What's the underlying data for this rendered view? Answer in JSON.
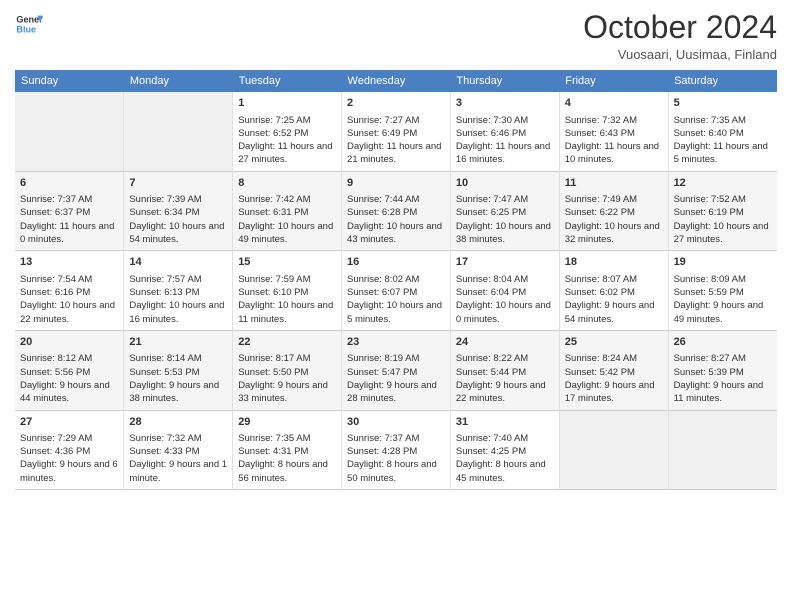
{
  "header": {
    "logo_line1": "General",
    "logo_line2": "Blue",
    "month_title": "October 2024",
    "subtitle": "Vuosaari, Uusimaa, Finland"
  },
  "days_of_week": [
    "Sunday",
    "Monday",
    "Tuesday",
    "Wednesday",
    "Thursday",
    "Friday",
    "Saturday"
  ],
  "weeks": [
    {
      "days": [
        {
          "num": "",
          "empty": true
        },
        {
          "num": "",
          "empty": true
        },
        {
          "num": "1",
          "sunrise": "Sunrise: 7:25 AM",
          "sunset": "Sunset: 6:52 PM",
          "daylight": "Daylight: 11 hours and 27 minutes."
        },
        {
          "num": "2",
          "sunrise": "Sunrise: 7:27 AM",
          "sunset": "Sunset: 6:49 PM",
          "daylight": "Daylight: 11 hours and 21 minutes."
        },
        {
          "num": "3",
          "sunrise": "Sunrise: 7:30 AM",
          "sunset": "Sunset: 6:46 PM",
          "daylight": "Daylight: 11 hours and 16 minutes."
        },
        {
          "num": "4",
          "sunrise": "Sunrise: 7:32 AM",
          "sunset": "Sunset: 6:43 PM",
          "daylight": "Daylight: 11 hours and 10 minutes."
        },
        {
          "num": "5",
          "sunrise": "Sunrise: 7:35 AM",
          "sunset": "Sunset: 6:40 PM",
          "daylight": "Daylight: 11 hours and 5 minutes."
        }
      ]
    },
    {
      "days": [
        {
          "num": "6",
          "sunrise": "Sunrise: 7:37 AM",
          "sunset": "Sunset: 6:37 PM",
          "daylight": "Daylight: 11 hours and 0 minutes."
        },
        {
          "num": "7",
          "sunrise": "Sunrise: 7:39 AM",
          "sunset": "Sunset: 6:34 PM",
          "daylight": "Daylight: 10 hours and 54 minutes."
        },
        {
          "num": "8",
          "sunrise": "Sunrise: 7:42 AM",
          "sunset": "Sunset: 6:31 PM",
          "daylight": "Daylight: 10 hours and 49 minutes."
        },
        {
          "num": "9",
          "sunrise": "Sunrise: 7:44 AM",
          "sunset": "Sunset: 6:28 PM",
          "daylight": "Daylight: 10 hours and 43 minutes."
        },
        {
          "num": "10",
          "sunrise": "Sunrise: 7:47 AM",
          "sunset": "Sunset: 6:25 PM",
          "daylight": "Daylight: 10 hours and 38 minutes."
        },
        {
          "num": "11",
          "sunrise": "Sunrise: 7:49 AM",
          "sunset": "Sunset: 6:22 PM",
          "daylight": "Daylight: 10 hours and 32 minutes."
        },
        {
          "num": "12",
          "sunrise": "Sunrise: 7:52 AM",
          "sunset": "Sunset: 6:19 PM",
          "daylight": "Daylight: 10 hours and 27 minutes."
        }
      ]
    },
    {
      "days": [
        {
          "num": "13",
          "sunrise": "Sunrise: 7:54 AM",
          "sunset": "Sunset: 6:16 PM",
          "daylight": "Daylight: 10 hours and 22 minutes."
        },
        {
          "num": "14",
          "sunrise": "Sunrise: 7:57 AM",
          "sunset": "Sunset: 6:13 PM",
          "daylight": "Daylight: 10 hours and 16 minutes."
        },
        {
          "num": "15",
          "sunrise": "Sunrise: 7:59 AM",
          "sunset": "Sunset: 6:10 PM",
          "daylight": "Daylight: 10 hours and 11 minutes."
        },
        {
          "num": "16",
          "sunrise": "Sunrise: 8:02 AM",
          "sunset": "Sunset: 6:07 PM",
          "daylight": "Daylight: 10 hours and 5 minutes."
        },
        {
          "num": "17",
          "sunrise": "Sunrise: 8:04 AM",
          "sunset": "Sunset: 6:04 PM",
          "daylight": "Daylight: 10 hours and 0 minutes."
        },
        {
          "num": "18",
          "sunrise": "Sunrise: 8:07 AM",
          "sunset": "Sunset: 6:02 PM",
          "daylight": "Daylight: 9 hours and 54 minutes."
        },
        {
          "num": "19",
          "sunrise": "Sunrise: 8:09 AM",
          "sunset": "Sunset: 5:59 PM",
          "daylight": "Daylight: 9 hours and 49 minutes."
        }
      ]
    },
    {
      "days": [
        {
          "num": "20",
          "sunrise": "Sunrise: 8:12 AM",
          "sunset": "Sunset: 5:56 PM",
          "daylight": "Daylight: 9 hours and 44 minutes."
        },
        {
          "num": "21",
          "sunrise": "Sunrise: 8:14 AM",
          "sunset": "Sunset: 5:53 PM",
          "daylight": "Daylight: 9 hours and 38 minutes."
        },
        {
          "num": "22",
          "sunrise": "Sunrise: 8:17 AM",
          "sunset": "Sunset: 5:50 PM",
          "daylight": "Daylight: 9 hours and 33 minutes."
        },
        {
          "num": "23",
          "sunrise": "Sunrise: 8:19 AM",
          "sunset": "Sunset: 5:47 PM",
          "daylight": "Daylight: 9 hours and 28 minutes."
        },
        {
          "num": "24",
          "sunrise": "Sunrise: 8:22 AM",
          "sunset": "Sunset: 5:44 PM",
          "daylight": "Daylight: 9 hours and 22 minutes."
        },
        {
          "num": "25",
          "sunrise": "Sunrise: 8:24 AM",
          "sunset": "Sunset: 5:42 PM",
          "daylight": "Daylight: 9 hours and 17 minutes."
        },
        {
          "num": "26",
          "sunrise": "Sunrise: 8:27 AM",
          "sunset": "Sunset: 5:39 PM",
          "daylight": "Daylight: 9 hours and 11 minutes."
        }
      ]
    },
    {
      "days": [
        {
          "num": "27",
          "sunrise": "Sunrise: 7:29 AM",
          "sunset": "Sunset: 4:36 PM",
          "daylight": "Daylight: 9 hours and 6 minutes."
        },
        {
          "num": "28",
          "sunrise": "Sunrise: 7:32 AM",
          "sunset": "Sunset: 4:33 PM",
          "daylight": "Daylight: 9 hours and 1 minute."
        },
        {
          "num": "29",
          "sunrise": "Sunrise: 7:35 AM",
          "sunset": "Sunset: 4:31 PM",
          "daylight": "Daylight: 8 hours and 56 minutes."
        },
        {
          "num": "30",
          "sunrise": "Sunrise: 7:37 AM",
          "sunset": "Sunset: 4:28 PM",
          "daylight": "Daylight: 8 hours and 50 minutes."
        },
        {
          "num": "31",
          "sunrise": "Sunrise: 7:40 AM",
          "sunset": "Sunset: 4:25 PM",
          "daylight": "Daylight: 8 hours and 45 minutes."
        },
        {
          "num": "",
          "empty": true
        },
        {
          "num": "",
          "empty": true
        }
      ]
    }
  ]
}
